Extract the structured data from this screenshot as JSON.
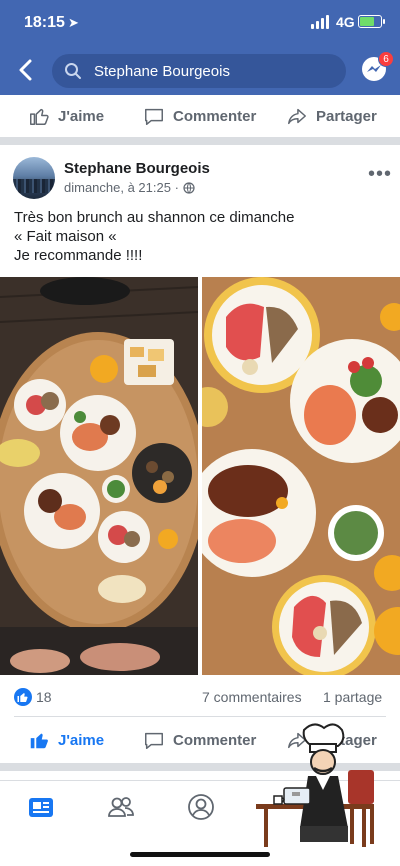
{
  "status_bar": {
    "time": "18:15",
    "network": "4G"
  },
  "header": {
    "search_text": "Stephane Bourgeois",
    "messenger_badge": "6"
  },
  "top_actions": {
    "like": "J'aime",
    "comment": "Commenter",
    "share": "Partager"
  },
  "post": {
    "author": "Stephane Bourgeois",
    "timestamp": "dimanche, à 21:25 ·",
    "text_lines": [
      "Très bon brunch au shannon ce dimanche",
      "« Fait maison «",
      "Je recommande !!!!"
    ],
    "reaction_count": "18",
    "comments_count": "7 commentaires",
    "shares_count": "1 partage"
  },
  "bottom_actions": {
    "like": "J'aime",
    "comment": "Commenter",
    "share": "Partager"
  },
  "colors": {
    "brand": "#4267b2",
    "like_active": "#1877f2",
    "muted": "#606770",
    "divider": "#dadde1"
  },
  "icons": [
    "location-arrow-icon",
    "signal-icon",
    "battery-icon",
    "back-icon",
    "search-icon",
    "messenger-icon",
    "thumbs-up-icon",
    "comment-icon",
    "share-icon",
    "globe-icon",
    "more-icon",
    "news-feed-icon",
    "friends-icon",
    "profile-icon"
  ]
}
